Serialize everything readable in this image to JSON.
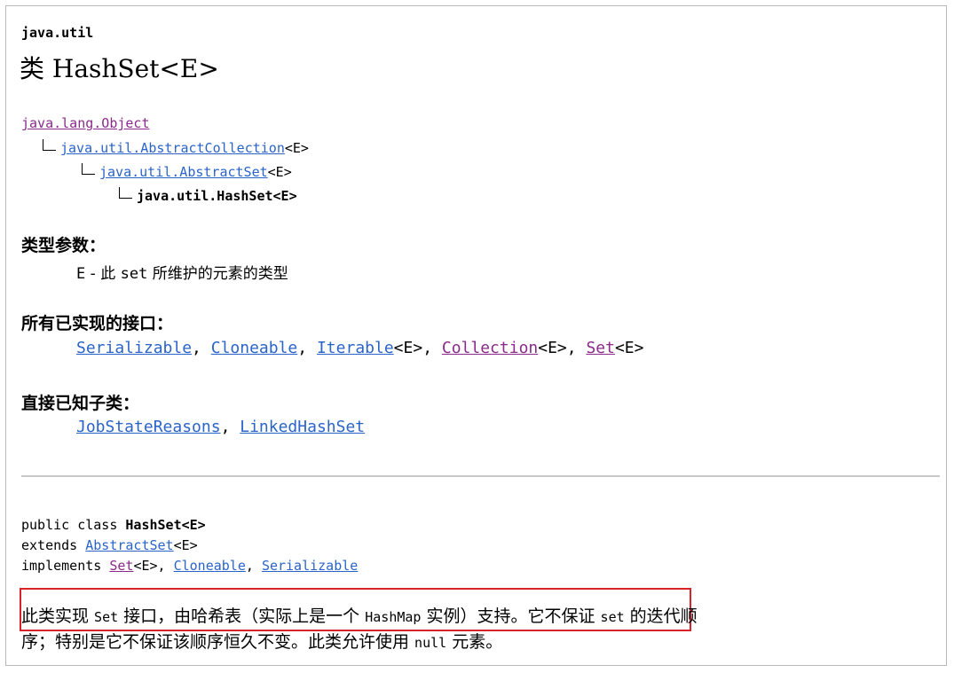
{
  "header": {
    "package": "java.util",
    "title_prefix": "类",
    "title_class": "HashSet<E>"
  },
  "hierarchy": [
    {
      "link": "java.lang.Object",
      "suffix": "",
      "visited": true
    },
    {
      "link": "java.util.AbstractCollection",
      "suffix": "<E>",
      "visited": false
    },
    {
      "link": "java.util.AbstractSet",
      "suffix": "<E>",
      "visited": false
    },
    {
      "current": "java.util.HashSet<E>"
    }
  ],
  "type_params": {
    "heading": "类型参数：",
    "param": "E",
    "dash": " - 此 ",
    "set_word": "set",
    "desc": " 所维护的元素的类型"
  },
  "interfaces": {
    "heading": "所有已实现的接口：",
    "items": [
      {
        "label": "Serializable",
        "suffix": "",
        "visited": false
      },
      {
        "label": "Cloneable",
        "suffix": "",
        "visited": false
      },
      {
        "label": "Iterable",
        "suffix": "<E>",
        "visited": false
      },
      {
        "label": "Collection",
        "suffix": "<E>",
        "visited": true
      },
      {
        "label": "Set",
        "suffix": "<E>",
        "visited": true
      }
    ]
  },
  "subclasses": {
    "heading": "直接已知子类：",
    "items": [
      {
        "label": "JobStateReasons"
      },
      {
        "label": "LinkedHashSet"
      }
    ]
  },
  "declaration": {
    "line1_prefix": "public class ",
    "line1_name": "HashSet<E>",
    "line2_prefix": "extends ",
    "line2_link": "AbstractSet",
    "line2_suffix": "<E>",
    "line3_prefix": "implements ",
    "line3_link1": "Set",
    "line3_link1_suffix": "<E>, ",
    "line3_link2": "Cloneable",
    "line3_sep": ", ",
    "line3_link3": "Serializable"
  },
  "description": {
    "l1a": "此类实现 ",
    "l1b": "Set",
    "l1c": " 接口，由哈希表（实际上是一个 ",
    "l1d": "HashMap",
    "l1e": " 实例）支持。它不保证 ",
    "l1f": "set",
    "l1g": " 的迭代顺",
    "l2a": "序；特别是它不保证该顺序恒久不变。此类允许使用 ",
    "l2b": "null",
    "l2c": " 元素。"
  },
  "colors": {
    "link": "#2a64c8",
    "visited_link": "#8a2a8a",
    "highlight_box": "#d9232b"
  }
}
